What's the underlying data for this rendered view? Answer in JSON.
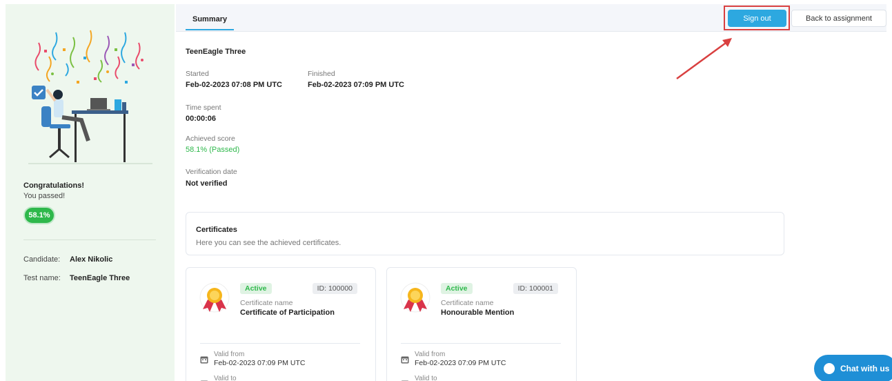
{
  "sidebar": {
    "congrats_title": "Congratulations!",
    "congrats_sub": "You passed!",
    "score": "58.1%",
    "candidate_label": "Candidate:",
    "candidate_value": "Alex Nikolic",
    "test_label": "Test name:",
    "test_value": "TeenEagle Three"
  },
  "tabs": {
    "summary": "Summary"
  },
  "toolbar": {
    "sign_out": "Sign out",
    "back": "Back to assignment"
  },
  "summary": {
    "test_title": "TeenEagle Three",
    "started_label": "Started",
    "started_value": "Feb-02-2023 07:08 PM UTC",
    "finished_label": "Finished",
    "finished_value": "Feb-02-2023 07:09 PM UTC",
    "time_label": "Time spent",
    "time_value": "00:00:06",
    "score_label": "Achieved score",
    "score_value": "58.1% (Passed)",
    "verify_label": "Verification date",
    "verify_value": "Not verified"
  },
  "certificates": {
    "title": "Certificates",
    "description": "Here you can see the achieved certificates.",
    "items": [
      {
        "status": "Active",
        "id": "ID: 100000",
        "name_label": "Certificate name",
        "name": "Certificate of Participation",
        "valid_from_label": "Valid from",
        "valid_from": "Feb-02-2023 07:09 PM UTC",
        "valid_to_label": "Valid to"
      },
      {
        "status": "Active",
        "id": "ID: 100001",
        "name_label": "Certificate name",
        "name": "Honourable Mention",
        "valid_from_label": "Valid from",
        "valid_from": "Feb-02-2023 07:09 PM UTC",
        "valid_to_label": "Valid to"
      }
    ]
  },
  "chat": {
    "label": "Chat with us"
  },
  "colors": {
    "accent_blue": "#2da8e0",
    "success_green": "#2eb84b",
    "annotation_red": "#d94040",
    "sidebar_bg": "#eef7ee"
  }
}
